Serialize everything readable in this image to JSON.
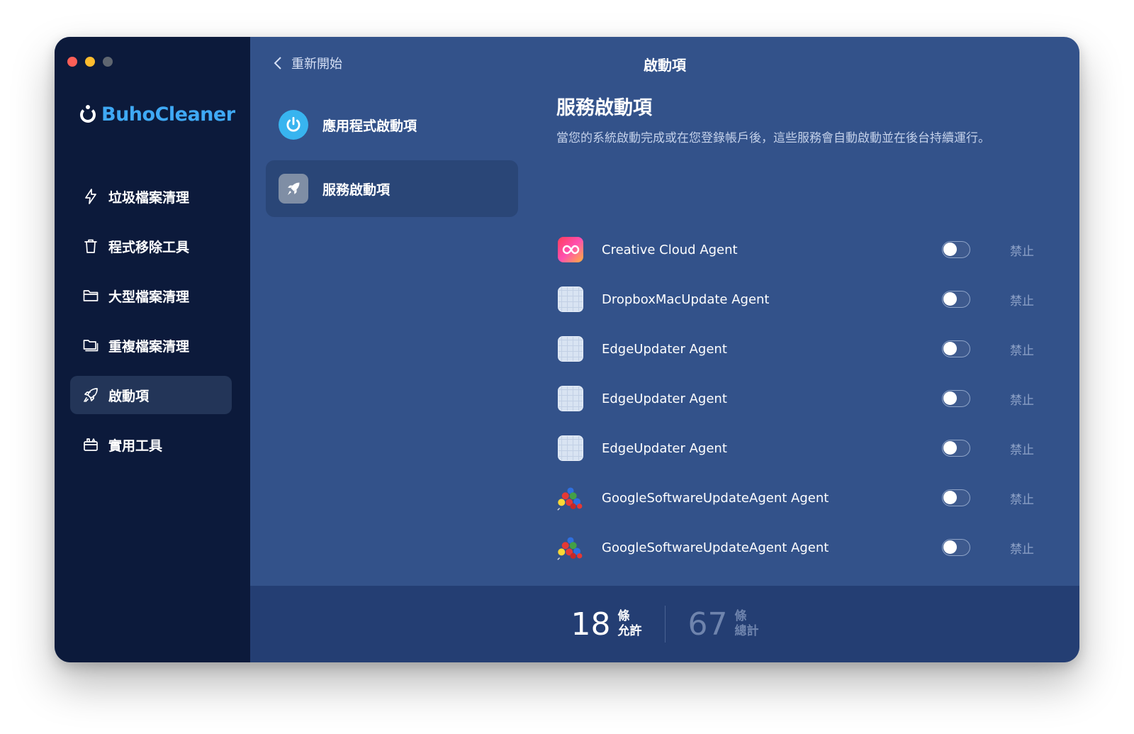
{
  "sidebar": {
    "brand": "BuhoCleaner",
    "items": [
      {
        "label": "垃圾檔案清理",
        "icon": "lightning-icon"
      },
      {
        "label": "程式移除工具",
        "icon": "trash-icon"
      },
      {
        "label": "大型檔案清理",
        "icon": "folder-icon"
      },
      {
        "label": "重複檔案清理",
        "icon": "duplicate-folder-icon"
      },
      {
        "label": "啟動項",
        "icon": "rocket-icon",
        "active": true
      },
      {
        "label": "實用工具",
        "icon": "toolbox-icon"
      }
    ]
  },
  "header": {
    "back_label": "重新開始",
    "title": "啟動項"
  },
  "categories": [
    {
      "label": "應用程式啟動項",
      "icon": "power-icon"
    },
    {
      "label": "服務啟動項",
      "icon": "rocket-icon",
      "active": true
    }
  ],
  "section": {
    "title": "服務啟動項",
    "description": "當您的系統啟動完成或在您登錄帳戶後，這些服務會自動啟動並在後台持續運行。"
  },
  "services": [
    {
      "name": "Creative Cloud Agent",
      "status": "禁止",
      "icon": "creative-cloud-icon",
      "enabled": false
    },
    {
      "name": "DropboxMacUpdate Agent",
      "status": "禁止",
      "icon": "generic-app-icon",
      "enabled": false
    },
    {
      "name": "EdgeUpdater Agent",
      "status": "禁止",
      "icon": "generic-app-icon",
      "enabled": false
    },
    {
      "name": "EdgeUpdater Agent",
      "status": "禁止",
      "icon": "generic-app-icon",
      "enabled": false
    },
    {
      "name": "EdgeUpdater Agent",
      "status": "禁止",
      "icon": "generic-app-icon",
      "enabled": false
    },
    {
      "name": "GoogleSoftwareUpdateAgent Agent",
      "status": "禁止",
      "icon": "google-update-icon",
      "enabled": false
    },
    {
      "name": "GoogleSoftwareUpdateAgent Agent",
      "status": "禁止",
      "icon": "google-update-icon",
      "enabled": false
    }
  ],
  "footer": {
    "allowed": {
      "count": "18",
      "unit": "條",
      "label": "允許"
    },
    "total": {
      "count": "67",
      "unit": "條",
      "label": "總計"
    }
  },
  "colors": {
    "sidebar_bg": "#0c1a3b",
    "main_bg": "#33528a",
    "footer_bg": "#243e73",
    "brand": "#3fa9f5",
    "traffic_red": "#fe5f57",
    "traffic_yellow": "#febc2e",
    "traffic_gray": "#5f6670"
  }
}
